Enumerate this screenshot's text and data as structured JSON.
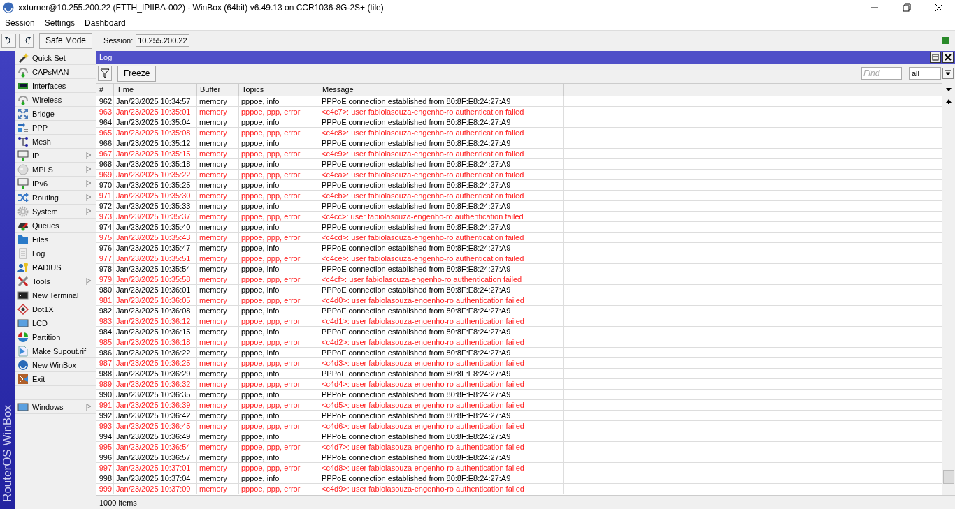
{
  "window": {
    "title": "xxturner@10.255.200.22 (FTTH_IPIIBA-002) - WinBox (64bit) v6.49.13 on CCR1036-8G-2S+ (tile)"
  },
  "menu": [
    "Session",
    "Settings",
    "Dashboard"
  ],
  "toolbar": {
    "safe_mode": "Safe Mode",
    "session_label": "Session:",
    "session_value": "10.255.200.22"
  },
  "sidebar": {
    "brand": "RouterOS WinBox",
    "items": [
      {
        "label": "Quick Set",
        "submenu": false
      },
      {
        "label": "CAPsMAN",
        "submenu": false
      },
      {
        "label": "Interfaces",
        "submenu": false
      },
      {
        "label": "Wireless",
        "submenu": false
      },
      {
        "label": "Bridge",
        "submenu": false
      },
      {
        "label": "PPP",
        "submenu": false
      },
      {
        "label": "Mesh",
        "submenu": false
      },
      {
        "label": "IP",
        "submenu": true
      },
      {
        "label": "MPLS",
        "submenu": true
      },
      {
        "label": "IPv6",
        "submenu": true
      },
      {
        "label": "Routing",
        "submenu": true
      },
      {
        "label": "System",
        "submenu": true
      },
      {
        "label": "Queues",
        "submenu": false
      },
      {
        "label": "Files",
        "submenu": false
      },
      {
        "label": "Log",
        "submenu": false
      },
      {
        "label": "RADIUS",
        "submenu": false
      },
      {
        "label": "Tools",
        "submenu": true
      },
      {
        "label": "New Terminal",
        "submenu": false
      },
      {
        "label": "Dot1X",
        "submenu": false
      },
      {
        "label": "LCD",
        "submenu": false
      },
      {
        "label": "Partition",
        "submenu": false
      },
      {
        "label": "Make Supout.rif",
        "submenu": false
      },
      {
        "label": "New WinBox",
        "submenu": false
      },
      {
        "label": "Exit",
        "submenu": false
      }
    ],
    "bottom_items": [
      {
        "label": "Windows",
        "submenu": true
      }
    ]
  },
  "log_window": {
    "title": "Log",
    "freeze": "Freeze",
    "find": {
      "placeholder": "Find"
    },
    "buffer_select": {
      "value": "all"
    },
    "columns": [
      "#",
      "Time",
      "Buffer",
      "Topics",
      "Message"
    ],
    "rows": [
      {
        "num": "962",
        "time": "Jan/23/2025 10:34:57",
        "buffer": "memory",
        "topics": "pppoe, info",
        "message": "PPPoE connection established from 80:8F:E8:24:27:A9",
        "kind": "info"
      },
      {
        "num": "963",
        "time": "Jan/23/2025 10:35:01",
        "buffer": "memory",
        "topics": "pppoe, ppp, error",
        "message": "<c4c7>: user fabiolasouza-engenho-ro authentication failed",
        "kind": "error"
      },
      {
        "num": "964",
        "time": "Jan/23/2025 10:35:04",
        "buffer": "memory",
        "topics": "pppoe, info",
        "message": "PPPoE connection established from 80:8F:E8:24:27:A9",
        "kind": "info"
      },
      {
        "num": "965",
        "time": "Jan/23/2025 10:35:08",
        "buffer": "memory",
        "topics": "pppoe, ppp, error",
        "message": "<c4c8>: user fabiolasouza-engenho-ro authentication failed",
        "kind": "error"
      },
      {
        "num": "966",
        "time": "Jan/23/2025 10:35:12",
        "buffer": "memory",
        "topics": "pppoe, info",
        "message": "PPPoE connection established from 80:8F:E8:24:27:A9",
        "kind": "info"
      },
      {
        "num": "967",
        "time": "Jan/23/2025 10:35:15",
        "buffer": "memory",
        "topics": "pppoe, ppp, error",
        "message": "<c4c9>: user fabiolasouza-engenho-ro authentication failed",
        "kind": "error"
      },
      {
        "num": "968",
        "time": "Jan/23/2025 10:35:18",
        "buffer": "memory",
        "topics": "pppoe, info",
        "message": "PPPoE connection established from 80:8F:E8:24:27:A9",
        "kind": "info"
      },
      {
        "num": "969",
        "time": "Jan/23/2025 10:35:22",
        "buffer": "memory",
        "topics": "pppoe, ppp, error",
        "message": "<c4ca>: user fabiolasouza-engenho-ro authentication failed",
        "kind": "error"
      },
      {
        "num": "970",
        "time": "Jan/23/2025 10:35:25",
        "buffer": "memory",
        "topics": "pppoe, info",
        "message": "PPPoE connection established from 80:8F:E8:24:27:A9",
        "kind": "info"
      },
      {
        "num": "971",
        "time": "Jan/23/2025 10:35:30",
        "buffer": "memory",
        "topics": "pppoe, ppp, error",
        "message": "<c4cb>: user fabiolasouza-engenho-ro authentication failed",
        "kind": "error"
      },
      {
        "num": "972",
        "time": "Jan/23/2025 10:35:33",
        "buffer": "memory",
        "topics": "pppoe, info",
        "message": "PPPoE connection established from 80:8F:E8:24:27:A9",
        "kind": "info"
      },
      {
        "num": "973",
        "time": "Jan/23/2025 10:35:37",
        "buffer": "memory",
        "topics": "pppoe, ppp, error",
        "message": "<c4cc>: user fabiolasouza-engenho-ro authentication failed",
        "kind": "error"
      },
      {
        "num": "974",
        "time": "Jan/23/2025 10:35:40",
        "buffer": "memory",
        "topics": "pppoe, info",
        "message": "PPPoE connection established from 80:8F:E8:24:27:A9",
        "kind": "info"
      },
      {
        "num": "975",
        "time": "Jan/23/2025 10:35:43",
        "buffer": "memory",
        "topics": "pppoe, ppp, error",
        "message": "<c4cd>: user fabiolasouza-engenho-ro authentication failed",
        "kind": "error"
      },
      {
        "num": "976",
        "time": "Jan/23/2025 10:35:47",
        "buffer": "memory",
        "topics": "pppoe, info",
        "message": "PPPoE connection established from 80:8F:E8:24:27:A9",
        "kind": "info"
      },
      {
        "num": "977",
        "time": "Jan/23/2025 10:35:51",
        "buffer": "memory",
        "topics": "pppoe, ppp, error",
        "message": "<c4ce>: user fabiolasouza-engenho-ro authentication failed",
        "kind": "error"
      },
      {
        "num": "978",
        "time": "Jan/23/2025 10:35:54",
        "buffer": "memory",
        "topics": "pppoe, info",
        "message": "PPPoE connection established from 80:8F:E8:24:27:A9",
        "kind": "info"
      },
      {
        "num": "979",
        "time": "Jan/23/2025 10:35:58",
        "buffer": "memory",
        "topics": "pppoe, ppp, error",
        "message": "<c4cf>: user fabiolasouza-engenho-ro authentication failed",
        "kind": "error"
      },
      {
        "num": "980",
        "time": "Jan/23/2025 10:36:01",
        "buffer": "memory",
        "topics": "pppoe, info",
        "message": "PPPoE connection established from 80:8F:E8:24:27:A9",
        "kind": "info"
      },
      {
        "num": "981",
        "time": "Jan/23/2025 10:36:05",
        "buffer": "memory",
        "topics": "pppoe, ppp, error",
        "message": "<c4d0>: user fabiolasouza-engenho-ro authentication failed",
        "kind": "error"
      },
      {
        "num": "982",
        "time": "Jan/23/2025 10:36:08",
        "buffer": "memory",
        "topics": "pppoe, info",
        "message": "PPPoE connection established from 80:8F:E8:24:27:A9",
        "kind": "info"
      },
      {
        "num": "983",
        "time": "Jan/23/2025 10:36:12",
        "buffer": "memory",
        "topics": "pppoe, ppp, error",
        "message": "<c4d1>: user fabiolasouza-engenho-ro authentication failed",
        "kind": "error"
      },
      {
        "num": "984",
        "time": "Jan/23/2025 10:36:15",
        "buffer": "memory",
        "topics": "pppoe, info",
        "message": "PPPoE connection established from 80:8F:E8:24:27:A9",
        "kind": "info"
      },
      {
        "num": "985",
        "time": "Jan/23/2025 10:36:18",
        "buffer": "memory",
        "topics": "pppoe, ppp, error",
        "message": "<c4d2>: user fabiolasouza-engenho-ro authentication failed",
        "kind": "error"
      },
      {
        "num": "986",
        "time": "Jan/23/2025 10:36:22",
        "buffer": "memory",
        "topics": "pppoe, info",
        "message": "PPPoE connection established from 80:8F:E8:24:27:A9",
        "kind": "info"
      },
      {
        "num": "987",
        "time": "Jan/23/2025 10:36:25",
        "buffer": "memory",
        "topics": "pppoe, ppp, error",
        "message": "<c4d3>: user fabiolasouza-engenho-ro authentication failed",
        "kind": "error"
      },
      {
        "num": "988",
        "time": "Jan/23/2025 10:36:29",
        "buffer": "memory",
        "topics": "pppoe, info",
        "message": "PPPoE connection established from 80:8F:E8:24:27:A9",
        "kind": "info"
      },
      {
        "num": "989",
        "time": "Jan/23/2025 10:36:32",
        "buffer": "memory",
        "topics": "pppoe, ppp, error",
        "message": "<c4d4>: user fabiolasouza-engenho-ro authentication failed",
        "kind": "error"
      },
      {
        "num": "990",
        "time": "Jan/23/2025 10:36:35",
        "buffer": "memory",
        "topics": "pppoe, info",
        "message": "PPPoE connection established from 80:8F:E8:24:27:A9",
        "kind": "info"
      },
      {
        "num": "991",
        "time": "Jan/23/2025 10:36:39",
        "buffer": "memory",
        "topics": "pppoe, ppp, error",
        "message": "<c4d5>: user fabiolasouza-engenho-ro authentication failed",
        "kind": "error"
      },
      {
        "num": "992",
        "time": "Jan/23/2025 10:36:42",
        "buffer": "memory",
        "topics": "pppoe, info",
        "message": "PPPoE connection established from 80:8F:E8:24:27:A9",
        "kind": "info"
      },
      {
        "num": "993",
        "time": "Jan/23/2025 10:36:45",
        "buffer": "memory",
        "topics": "pppoe, ppp, error",
        "message": "<c4d6>: user fabiolasouza-engenho-ro authentication failed",
        "kind": "error"
      },
      {
        "num": "994",
        "time": "Jan/23/2025 10:36:49",
        "buffer": "memory",
        "topics": "pppoe, info",
        "message": "PPPoE connection established from 80:8F:E8:24:27:A9",
        "kind": "info"
      },
      {
        "num": "995",
        "time": "Jan/23/2025 10:36:54",
        "buffer": "memory",
        "topics": "pppoe, ppp, error",
        "message": "<c4d7>: user fabiolasouza-engenho-ro authentication failed",
        "kind": "error"
      },
      {
        "num": "996",
        "time": "Jan/23/2025 10:36:57",
        "buffer": "memory",
        "topics": "pppoe, info",
        "message": "PPPoE connection established from 80:8F:E8:24:27:A9",
        "kind": "info"
      },
      {
        "num": "997",
        "time": "Jan/23/2025 10:37:01",
        "buffer": "memory",
        "topics": "pppoe, ppp, error",
        "message": "<c4d8>: user fabiolasouza-engenho-ro authentication failed",
        "kind": "error"
      },
      {
        "num": "998",
        "time": "Jan/23/2025 10:37:04",
        "buffer": "memory",
        "topics": "pppoe, info",
        "message": "PPPoE connection established from 80:8F:E8:24:27:A9",
        "kind": "info"
      },
      {
        "num": "999",
        "time": "Jan/23/2025 10:37:09",
        "buffer": "memory",
        "topics": "pppoe, ppp, error",
        "message": "<c4d9>: user fabiolasouza-engenho-ro authentication failed",
        "kind": "error"
      }
    ],
    "status": "1000 items"
  }
}
